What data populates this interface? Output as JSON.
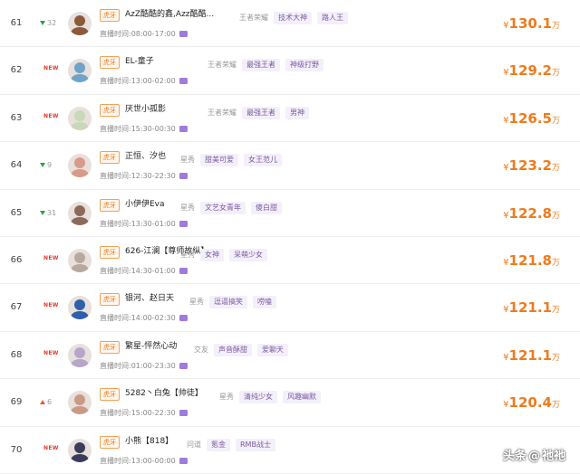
{
  "rows": [
    {
      "rank": "61",
      "change": {
        "dir": "down",
        "value": "32"
      },
      "platform": "虎牙",
      "name": "AzZ酷酷的鑫,Azz酷酷...",
      "category": "王者荣耀",
      "tags": [
        "技术大神",
        "路人王"
      ],
      "live_label": "直播时间:",
      "live_time": "08:00-17:00",
      "price": "130.1",
      "avatar_color": "#8a5a3c"
    },
    {
      "rank": "62",
      "change": {
        "dir": "new",
        "value": "NEW"
      },
      "platform": "虎牙",
      "name": "EL-童子",
      "category": "王者荣耀",
      "tags": [
        "最强王者",
        "神级打野"
      ],
      "live_label": "直播时间:",
      "live_time": "13:00-02:00",
      "price": "129.2",
      "avatar_color": "#6fa3c9"
    },
    {
      "rank": "63",
      "change": {
        "dir": "new",
        "value": "NEW"
      },
      "platform": "虎牙",
      "name": "厌世小孤影",
      "category": "王者荣耀",
      "tags": [
        "最强王者",
        "男神"
      ],
      "live_label": "直播时间:",
      "live_time": "15:30-00:30",
      "price": "126.5",
      "avatar_color": "#c9d8b8"
    },
    {
      "rank": "64",
      "change": {
        "dir": "down",
        "value": "9"
      },
      "platform": "虎牙",
      "name": "正恒、汐也",
      "category": "星秀",
      "tags": [
        "甜美可爱",
        "女王范儿"
      ],
      "live_label": "直播时间:",
      "live_time": "12:30-22:30",
      "price": "123.2",
      "avatar_color": "#d99a8a"
    },
    {
      "rank": "65",
      "change": {
        "dir": "down",
        "value": "31"
      },
      "platform": "虎牙",
      "name": "小伊伊Eva",
      "category": "星秀",
      "tags": [
        "文艺女青年",
        "傻白甜"
      ],
      "live_label": "直播时间:",
      "live_time": "13:30-01:00",
      "price": "122.8",
      "avatar_color": "#8c6a5a"
    },
    {
      "rank": "66",
      "change": {
        "dir": "new",
        "value": "NEW"
      },
      "platform": "虎牙",
      "name": "626-江澜【尊师故纵】",
      "category": "星秀",
      "tags": [
        "女神",
        "呆萌少女"
      ],
      "live_label": "直播时间:",
      "live_time": "14:30-01:00",
      "price": "121.8",
      "avatar_color": "#b8a8a0"
    },
    {
      "rank": "67",
      "change": {
        "dir": "new",
        "value": "NEW"
      },
      "platform": "虎牙",
      "name": "银河、赵日天",
      "category": "星秀",
      "tags": [
        "逗逼搞笑",
        "唠嗑"
      ],
      "live_label": "直播时间:",
      "live_time": "14:00-02:30",
      "price": "121.1",
      "avatar_color": "#2f5fa8"
    },
    {
      "rank": "68",
      "change": {
        "dir": "new",
        "value": "NEW"
      },
      "platform": "虎牙",
      "name": "繁星-怦然心动",
      "category": "交友",
      "tags": [
        "声音酥甜",
        "爱聊天"
      ],
      "live_label": "直播时间:",
      "live_time": "01:00-23:30",
      "price": "121.1",
      "avatar_color": "#b7a6c9"
    },
    {
      "rank": "69",
      "change": {
        "dir": "up",
        "value": "6"
      },
      "platform": "虎牙",
      "name": "5282丶白兔【帅徒】",
      "category": "星秀",
      "tags": [
        "清纯少女",
        "风趣幽默"
      ],
      "live_label": "直播时间:",
      "live_time": "15:00-22:30",
      "price": "120.4",
      "avatar_color": "#c99a86"
    },
    {
      "rank": "70",
      "change": {
        "dir": "new",
        "value": "NEW"
      },
      "platform": "虎牙",
      "name": "小熊【818】",
      "category": "问道",
      "tags": [
        "氪金",
        "RMB战士"
      ],
      "live_label": "直播时间:",
      "live_time": "13:00-00:00",
      "price": "",
      "avatar_color": "#3c3c5a"
    }
  ],
  "currency": "¥",
  "unit": "万",
  "watermark": {
    "source": "头条",
    "at": "@",
    "author": "祂祂"
  }
}
